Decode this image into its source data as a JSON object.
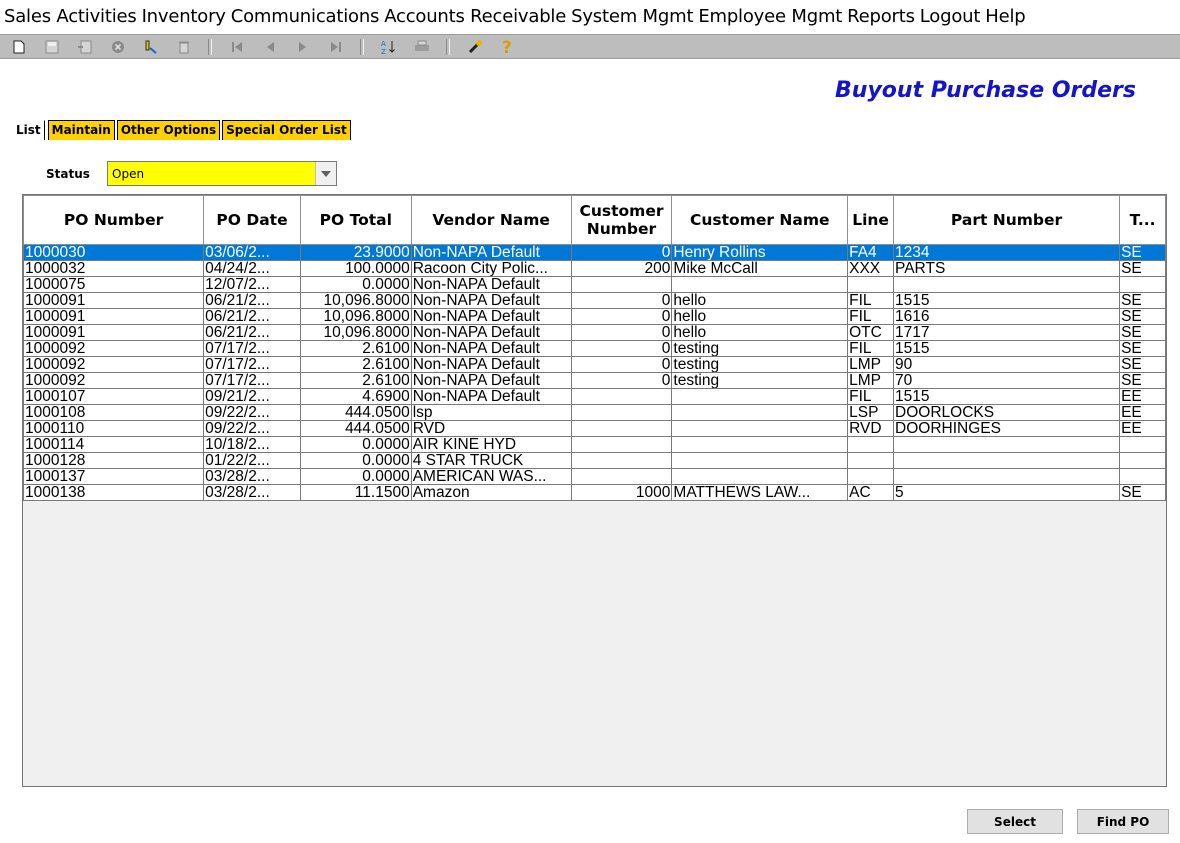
{
  "menu": [
    {
      "label": "Sales Activities"
    },
    {
      "label": "Inventory"
    },
    {
      "label": "Communications"
    },
    {
      "label": "Accounts Receivable"
    },
    {
      "label": "System Mgmt"
    },
    {
      "label": "Employee Mgmt"
    },
    {
      "label": "Reports"
    },
    {
      "label": "Logout"
    },
    {
      "label": "Help"
    }
  ],
  "toolbar": {
    "icons": [
      "new-icon",
      "save-icon",
      "copy-icon",
      "cancel-icon",
      "edit-icon",
      "delete-icon",
      "first-icon",
      "previous-icon",
      "next-icon",
      "last-icon",
      "sort-icon",
      "print-icon",
      "tools-icon",
      "help-icon"
    ]
  },
  "page": {
    "title": "Buyout Purchase Orders"
  },
  "tabs": [
    {
      "label": "List"
    },
    {
      "label": "Maintain"
    },
    {
      "label": "Other Options"
    },
    {
      "label": "Special Order List"
    }
  ],
  "status": {
    "label": "Status",
    "value": "Open"
  },
  "grid": {
    "columns": [
      {
        "label": "PO Number"
      },
      {
        "label": "PO Date"
      },
      {
        "label": "PO Total"
      },
      {
        "label": "Vendor Name"
      },
      {
        "label": "Customer Number"
      },
      {
        "label": "Customer Name"
      },
      {
        "label": "Line"
      },
      {
        "label": "Part Number"
      },
      {
        "label": "T..."
      }
    ],
    "rows": [
      [
        "1000030",
        "03/06/2...",
        "23.9000",
        "Non-NAPA Default",
        "0",
        "Henry Rollins",
        "FA4",
        "1234",
        "SE"
      ],
      [
        "1000032",
        "04/24/2...",
        "100.0000",
        "Racoon City Polic...",
        "200",
        "Mike McCall",
        "XXX",
        "PARTS",
        "SE"
      ],
      [
        "1000075",
        "12/07/2...",
        "0.0000",
        "Non-NAPA Default",
        "",
        "",
        "",
        "",
        ""
      ],
      [
        "1000091",
        "06/21/2...",
        "10,096.8000",
        "Non-NAPA Default",
        "0",
        "hello",
        "FIL",
        "1515",
        "SE"
      ],
      [
        "1000091",
        "06/21/2...",
        "10,096.8000",
        "Non-NAPA Default",
        "0",
        "hello",
        "FIL",
        "1616",
        "SE"
      ],
      [
        "1000091",
        "06/21/2...",
        "10,096.8000",
        "Non-NAPA Default",
        "0",
        "hello",
        "OTC",
        "1717",
        "SE"
      ],
      [
        "1000092",
        "07/17/2...",
        "2.6100",
        "Non-NAPA Default",
        "0",
        "testing",
        "FIL",
        "1515",
        "SE"
      ],
      [
        "1000092",
        "07/17/2...",
        "2.6100",
        "Non-NAPA Default",
        "0",
        "testing",
        "LMP",
        "90",
        "SE"
      ],
      [
        "1000092",
        "07/17/2...",
        "2.6100",
        "Non-NAPA Default",
        "0",
        "testing",
        "LMP",
        "70",
        "SE"
      ],
      [
        "1000107",
        "09/21/2...",
        "4.6900",
        "Non-NAPA Default",
        "",
        "",
        "FIL",
        "1515",
        "EE"
      ],
      [
        "1000108",
        "09/22/2...",
        "444.0500",
        "lsp",
        "",
        "",
        "LSP",
        "DOORLOCKS",
        "EE"
      ],
      [
        "1000110",
        "09/22/2...",
        "444.0500",
        "RVD",
        "",
        "",
        "RVD",
        "DOORHINGES",
        "EE"
      ],
      [
        "1000114",
        "10/18/2...",
        "0.0000",
        "AIR KINE HYD",
        "",
        "",
        "",
        "",
        ""
      ],
      [
        "1000128",
        "01/22/2...",
        "0.0000",
        "4 STAR TRUCK",
        "",
        "",
        "",
        "",
        ""
      ],
      [
        "1000137",
        "03/28/2...",
        "0.0000",
        "AMERICAN WAS...",
        "",
        "",
        "",
        "",
        ""
      ],
      [
        "1000138",
        "03/28/2...",
        "11.1500",
        "Amazon",
        "1000",
        "MATTHEWS LAW...",
        "AC",
        "5",
        "SE"
      ]
    ],
    "selected_row": 0
  },
  "buttons": {
    "select": "Select",
    "find_po": "Find PO"
  }
}
